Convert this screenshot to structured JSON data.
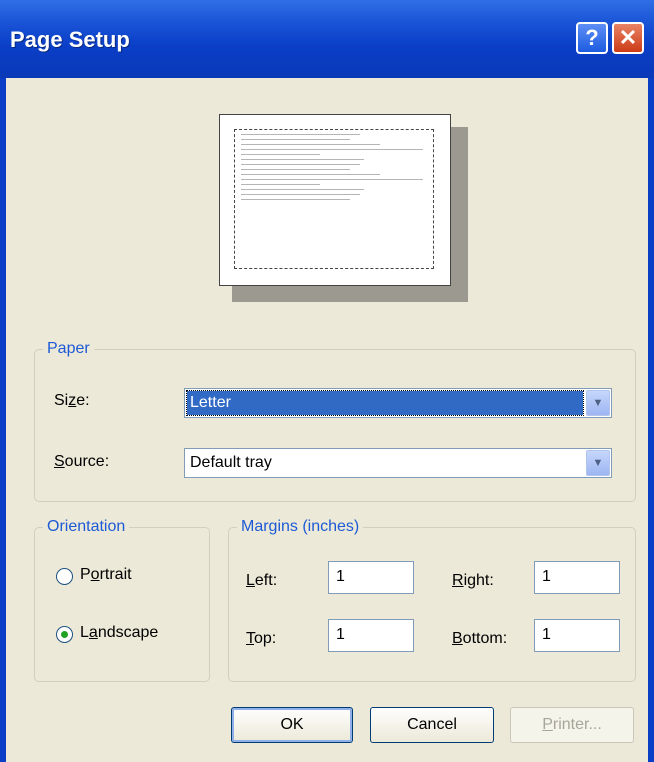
{
  "window": {
    "title": "Page Setup"
  },
  "titlebar_buttons": {
    "help": "?",
    "close": "✕"
  },
  "paper": {
    "legend": "Paper",
    "size_label_pre": "Si",
    "size_label_key": "z",
    "size_label_post": "e:",
    "size_value": "Letter",
    "source_label_key": "S",
    "source_label_post": "ource:",
    "source_value": "Default tray"
  },
  "orientation": {
    "legend": "Orientation",
    "portrait_pre": "P",
    "portrait_key": "o",
    "portrait_post": "rtrait",
    "landscape_pre": "L",
    "landscape_key": "a",
    "landscape_post": "ndscape",
    "selected": "Landscape"
  },
  "margins": {
    "legend": "Margins (inches)",
    "left_key": "L",
    "left_post": "eft:",
    "left_value": "1",
    "right_key": "R",
    "right_post": "ight:",
    "right_value": "1",
    "top_key": "T",
    "top_post": "op:",
    "top_value": "1",
    "bottom_key": "B",
    "bottom_post": "ottom:",
    "bottom_value": "1"
  },
  "buttons": {
    "ok": "OK",
    "cancel": "Cancel",
    "printer_key": "P",
    "printer_post": "rinter..."
  },
  "colors": {
    "title_bar": "#0a3ec7",
    "dialog_bg": "#ece9d8",
    "legend_text": "#1d5ad6",
    "selection": "#316ac5"
  }
}
